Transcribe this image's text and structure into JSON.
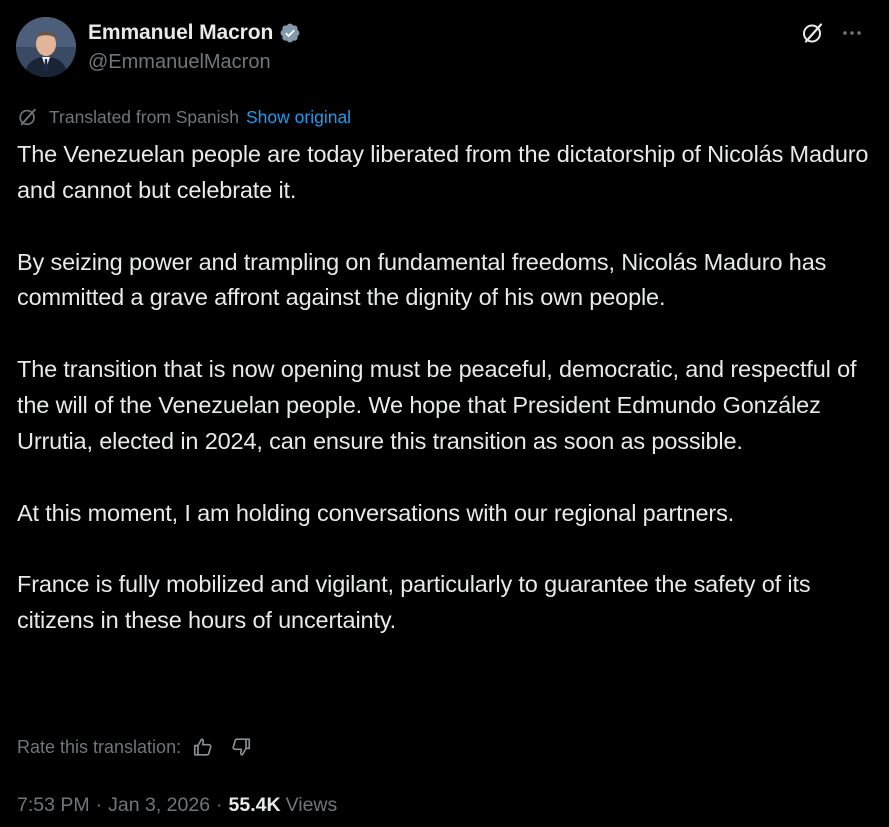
{
  "author": {
    "display_name": "Emmanuel Macron",
    "handle": "@EmmanuelMacron",
    "verified_icon": "verified-badge-icon",
    "verified_color": "#1d9bf0"
  },
  "header_actions": {
    "grok_icon": "grok-icon",
    "more_icon": "more-options-icon"
  },
  "translation": {
    "label": "Translated from Spanish",
    "show_original": "Show original",
    "icon": "translate-icon"
  },
  "tweet": {
    "paragraphs": [
      "The Venezuelan people are today liberated from the dictatorship of Nicolás Maduro and cannot but celebrate it.",
      "By seizing power and trampling on fundamental freedoms, Nicolás Maduro has committed a grave affront against the dignity of his own people.",
      "The transition that is now opening must be peaceful, democratic, and respectful of the will of the Venezuelan people. We hope that President Edmundo González Urrutia, elected in 2024, can ensure this transition as soon as possible.",
      "At this moment, I am holding conversations with our regional partners.",
      "France is fully mobilized and vigilant, particularly to guarantee the safety of its citizens in these hours of uncertainty."
    ]
  },
  "rating": {
    "label": "Rate this translation:",
    "thumbs_up_icon": "thumbs-up-icon",
    "thumbs_down_icon": "thumbs-down-icon"
  },
  "meta": {
    "time": "7:53 PM",
    "separator": "·",
    "date": "Jan 3, 2026",
    "views_count": "55.4K",
    "views_label": "Views"
  },
  "colors": {
    "background": "#000000",
    "text_primary": "#e7e9ea",
    "text_secondary": "#71767b",
    "accent": "#1d9bf0"
  }
}
